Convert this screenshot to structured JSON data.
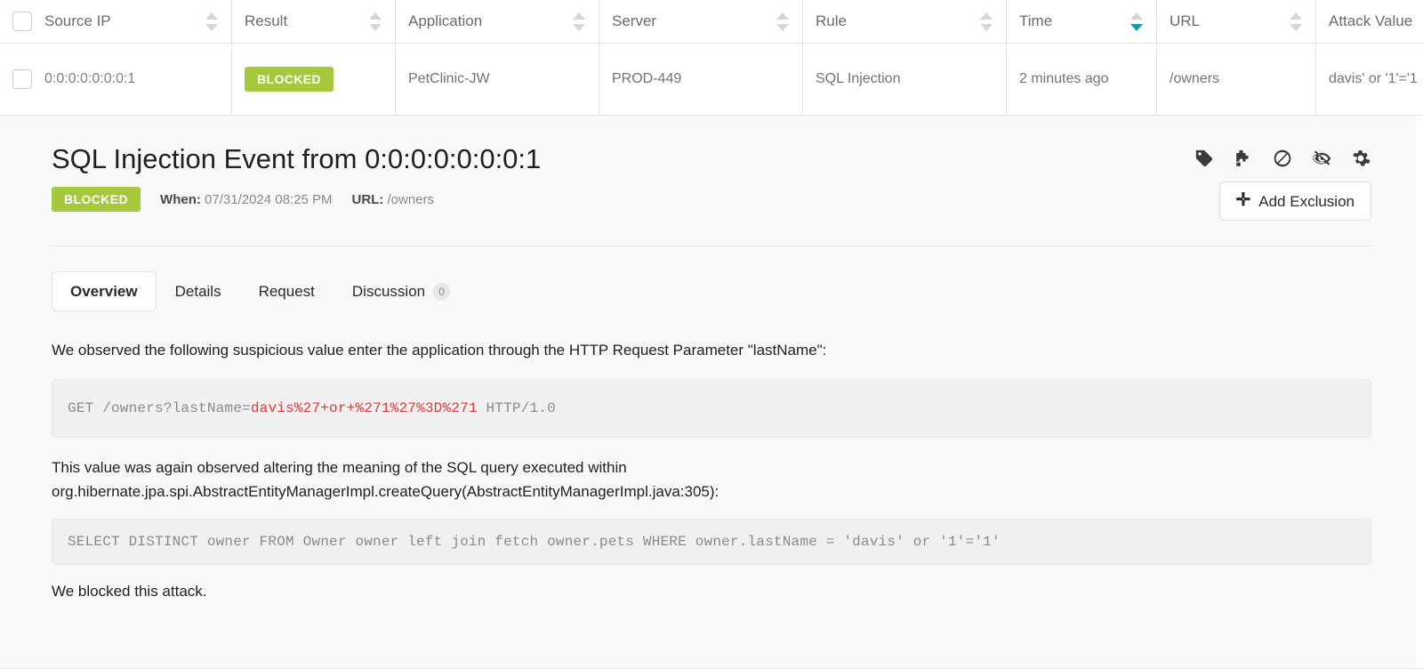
{
  "table": {
    "columns": [
      {
        "label": "Source IP",
        "sort": "none"
      },
      {
        "label": "Result",
        "sort": "none"
      },
      {
        "label": "Application",
        "sort": "none"
      },
      {
        "label": "Server",
        "sort": "none"
      },
      {
        "label": "Rule",
        "sort": "none"
      },
      {
        "label": "Time",
        "sort": "desc"
      },
      {
        "label": "URL",
        "sort": "none"
      },
      {
        "label": "Attack Value",
        "sort": "none"
      }
    ],
    "rows": [
      {
        "source_ip": "0:0:0:0:0:0:0:1",
        "result": "BLOCKED",
        "application": "PetClinic-JW",
        "server": "PROD-449",
        "rule": "SQL Injection",
        "time": "2 minutes ago",
        "url": "/owners",
        "attack_value": "davis' or '1'='1"
      }
    ]
  },
  "detail": {
    "title": "SQL Injection Event from 0:0:0:0:0:0:0:1",
    "status_badge": "BLOCKED",
    "when_label": "When:",
    "when_value": "07/31/2024 08:25 PM",
    "url_label": "URL:",
    "url_value": "/owners",
    "actions": {
      "icons": [
        {
          "name": "tag-icon",
          "title": "Tag"
        },
        {
          "name": "puzzle-piece-icon",
          "title": "Integrations"
        },
        {
          "name": "block-icon",
          "title": "Block"
        },
        {
          "name": "eye-slash-icon",
          "title": "Mark unread"
        },
        {
          "name": "gear-icon",
          "title": "Settings"
        }
      ],
      "add_exclusion_label": "Add Exclusion",
      "add_exclusion_plus": "✛"
    },
    "tabs": [
      {
        "label": "Overview",
        "active": true,
        "badge": null
      },
      {
        "label": "Details",
        "active": false,
        "badge": null
      },
      {
        "label": "Request",
        "active": false,
        "badge": null
      },
      {
        "label": "Discussion",
        "active": false,
        "badge": "0"
      }
    ],
    "overview": {
      "intro": "We observed the following suspicious value enter the application through the HTTP Request Parameter \"lastName\":",
      "request_code_prefix": "GET /owners?lastName=",
      "request_code_attack": "davis%27+or+%271%27%3D%271",
      "request_code_suffix": " HTTP/1.0",
      "middle_line1": "This value was again observed altering the meaning of the SQL query executed within",
      "middle_line2": "org.hibernate.jpa.spi.AbstractEntityManagerImpl.createQuery(AbstractEntityManagerImpl.java:305):",
      "sql_code": "SELECT DISTINCT owner FROM Owner owner left join fetch owner.pets WHERE owner.lastName = 'davis' or '1'='1'",
      "conclusion": "We blocked this attack."
    }
  },
  "colors": {
    "blocked_green": "#a6c83c",
    "sort_active_teal": "#00a3b4",
    "attack_red": "#e03a3a",
    "panel_bg": "#f8f8f8",
    "code_bg": "#f0f0f0"
  }
}
